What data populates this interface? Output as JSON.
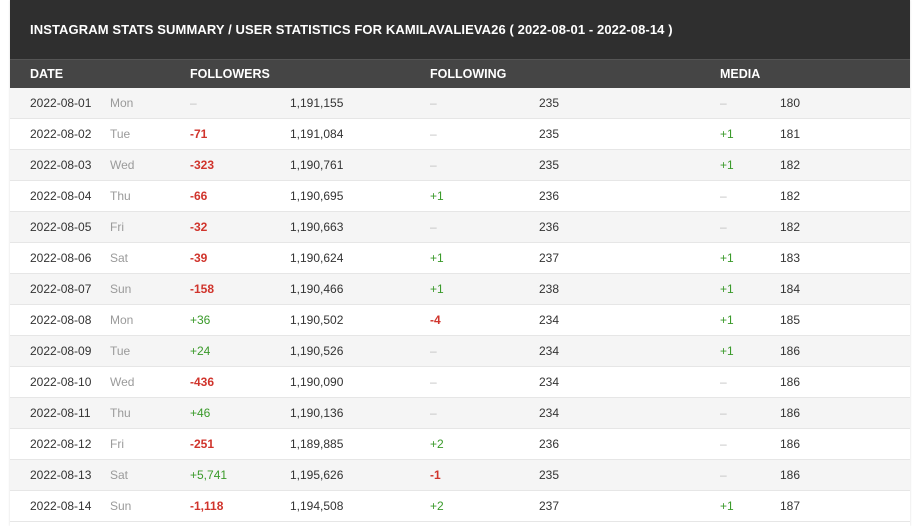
{
  "title": "INSTAGRAM STATS SUMMARY / USER STATISTICS FOR KAMILAVALIEVA26 ( 2022-08-01 - 2022-08-14 )",
  "columns": {
    "date": "DATE",
    "followers": "FOLLOWERS",
    "following": "FOLLOWING",
    "media": "MEDIA"
  },
  "colors": {
    "negative": "#d0342c",
    "positive": "#3a9a2a",
    "header_bg": "#454545",
    "title_bg": "#2f2f2f"
  },
  "rows": [
    {
      "date": "2022-08-01",
      "day": "Mon",
      "followers_change": "–",
      "followers": "1,191,155",
      "following_change": "–",
      "following": "235",
      "media_change": "–",
      "media": "180"
    },
    {
      "date": "2022-08-02",
      "day": "Tue",
      "followers_change": "-71",
      "followers": "1,191,084",
      "following_change": "–",
      "following": "235",
      "media_change": "+1",
      "media": "181"
    },
    {
      "date": "2022-08-03",
      "day": "Wed",
      "followers_change": "-323",
      "followers": "1,190,761",
      "following_change": "–",
      "following": "235",
      "media_change": "+1",
      "media": "182"
    },
    {
      "date": "2022-08-04",
      "day": "Thu",
      "followers_change": "-66",
      "followers": "1,190,695",
      "following_change": "+1",
      "following": "236",
      "media_change": "–",
      "media": "182"
    },
    {
      "date": "2022-08-05",
      "day": "Fri",
      "followers_change": "-32",
      "followers": "1,190,663",
      "following_change": "–",
      "following": "236",
      "media_change": "–",
      "media": "182"
    },
    {
      "date": "2022-08-06",
      "day": "Sat",
      "followers_change": "-39",
      "followers": "1,190,624",
      "following_change": "+1",
      "following": "237",
      "media_change": "+1",
      "media": "183"
    },
    {
      "date": "2022-08-07",
      "day": "Sun",
      "followers_change": "-158",
      "followers": "1,190,466",
      "following_change": "+1",
      "following": "238",
      "media_change": "+1",
      "media": "184"
    },
    {
      "date": "2022-08-08",
      "day": "Mon",
      "followers_change": "+36",
      "followers": "1,190,502",
      "following_change": "-4",
      "following": "234",
      "media_change": "+1",
      "media": "185"
    },
    {
      "date": "2022-08-09",
      "day": "Tue",
      "followers_change": "+24",
      "followers": "1,190,526",
      "following_change": "–",
      "following": "234",
      "media_change": "+1",
      "media": "186"
    },
    {
      "date": "2022-08-10",
      "day": "Wed",
      "followers_change": "-436",
      "followers": "1,190,090",
      "following_change": "–",
      "following": "234",
      "media_change": "–",
      "media": "186"
    },
    {
      "date": "2022-08-11",
      "day": "Thu",
      "followers_change": "+46",
      "followers": "1,190,136",
      "following_change": "–",
      "following": "234",
      "media_change": "–",
      "media": "186"
    },
    {
      "date": "2022-08-12",
      "day": "Fri",
      "followers_change": "-251",
      "followers": "1,189,885",
      "following_change": "+2",
      "following": "236",
      "media_change": "–",
      "media": "186"
    },
    {
      "date": "2022-08-13",
      "day": "Sat",
      "followers_change": "+5,741",
      "followers": "1,195,626",
      "following_change": "-1",
      "following": "235",
      "media_change": "–",
      "media": "186"
    },
    {
      "date": "2022-08-14",
      "day": "Sun",
      "followers_change": "-1,118",
      "followers": "1,194,508",
      "following_change": "+2",
      "following": "237",
      "media_change": "+1",
      "media": "187"
    }
  ]
}
